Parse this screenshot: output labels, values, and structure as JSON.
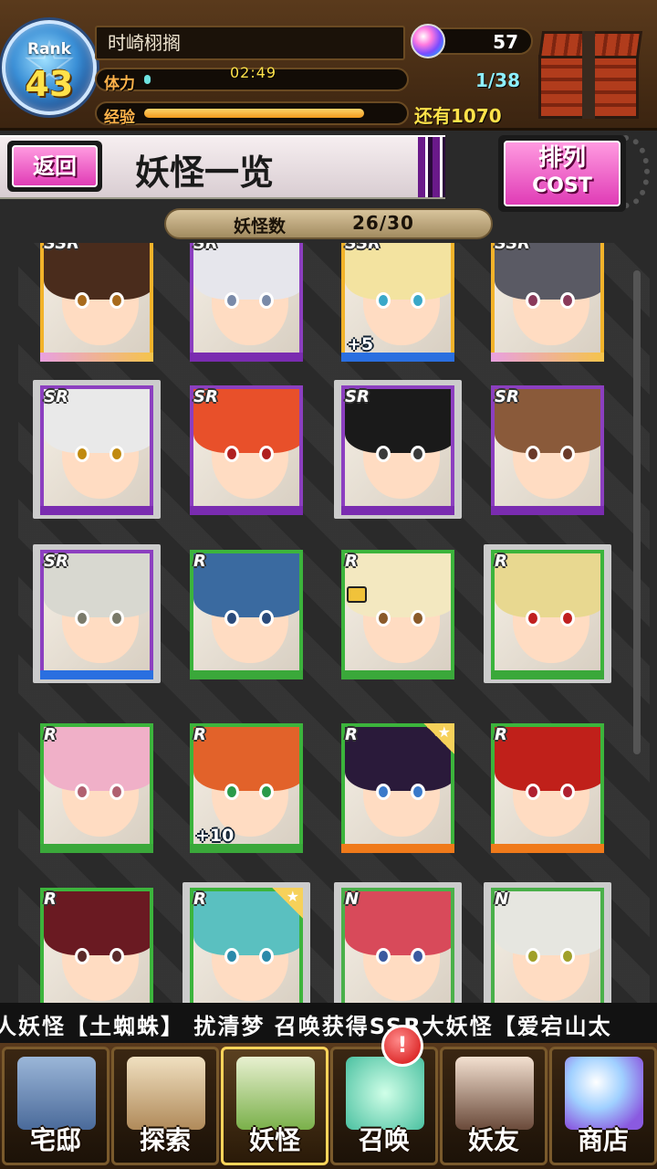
{
  "header": {
    "rank_label": "Rank",
    "rank_value": "43",
    "player_name": "时崎栩搁",
    "stamina_label": "体力",
    "stamina_timer": "02:49",
    "stamina_fraction": 0.026,
    "stamina_count": "1/38",
    "exp_label": "经验",
    "exp_fraction": 0.86,
    "exp_remaining": "还有1070",
    "gem_count": "57",
    "gem_icon": "gem-orb-icon",
    "present_icon": "present-box-icon"
  },
  "titlebar": {
    "back_label": "返回",
    "page_title": "妖怪一览",
    "sort_line1": "排列",
    "sort_line2": "COST"
  },
  "counter": {
    "label": "妖怪数",
    "value": "26/30"
  },
  "colors": {
    "accent_pink": "#e03cb6",
    "ssr_gold": "#f2b32a",
    "sr_purple": "#8c3fc0",
    "r_green": "#3cb43c",
    "highlight_yellow": "#ffe24a"
  },
  "cards": [
    {
      "rarity": "SSR",
      "plus": "",
      "hair": "#4a2c1c",
      "eyes": "#a86a1c"
    },
    {
      "rarity": "SR",
      "plus": "",
      "hair": "#e6e6ec",
      "eyes": "#7a8aa8"
    },
    {
      "rarity": "SSR",
      "plus": "+5",
      "hair": "#f3e3a0",
      "eyes": "#3aa8c8"
    },
    {
      "rarity": "SSR",
      "plus": "",
      "hair": "#5a5a64",
      "eyes": "#8a3a5a"
    },
    {
      "rarity": "SR",
      "plus": "",
      "hair": "#e9e9e9",
      "eyes": "#c08a10"
    },
    {
      "rarity": "SR",
      "plus": "",
      "hair": "#e8502a",
      "eyes": "#b02020"
    },
    {
      "rarity": "SR",
      "plus": "",
      "hair": "#1a1a1a",
      "eyes": "#3a3a3a"
    },
    {
      "rarity": "SR",
      "plus": "",
      "hair": "#8a5a3a",
      "eyes": "#6a3a2a"
    },
    {
      "rarity": "SR",
      "plus": "",
      "hair": "#d8d8d0",
      "eyes": "#7a7a6a"
    },
    {
      "rarity": "R",
      "plus": "",
      "hair": "#3a6aa0",
      "eyes": "#2a4a7a"
    },
    {
      "rarity": "R",
      "plus": "",
      "hair": "#f3e8c0",
      "eyes": "#8a5a2a"
    },
    {
      "rarity": "R",
      "plus": "",
      "hair": "#e8d890",
      "eyes": "#c02020"
    },
    {
      "rarity": "R",
      "plus": "",
      "hair": "#f0b0c8",
      "eyes": "#b06070"
    },
    {
      "rarity": "R",
      "plus": "+10",
      "hair": "#e2622a",
      "eyes": "#2a9a4a"
    },
    {
      "rarity": "R",
      "plus": "",
      "hair": "#2a1a3a",
      "eyes": "#3a7aca"
    },
    {
      "rarity": "R",
      "plus": "",
      "hair": "#c0201a",
      "eyes": "#b02030"
    },
    {
      "rarity": "R",
      "plus": "",
      "hair": "#6a1a22",
      "eyes": "#5a2a2a"
    },
    {
      "rarity": "R",
      "plus": "",
      "hair": "#5ac0c0",
      "eyes": "#2a8aaa"
    },
    {
      "rarity": "N",
      "plus": "",
      "hair": "#d84a5a",
      "eyes": "#3a5aa0"
    },
    {
      "rarity": "N",
      "plus": "",
      "hair": "#e6e6e0",
      "eyes": "#a0a02a"
    }
  ],
  "ticker_text": "人妖怪【土蜘蛛】 扰清梦 召唤获得SSR大妖怪【爱宕山太",
  "nav": [
    {
      "label": "宅邸",
      "icon": "mansion-icon"
    },
    {
      "label": "探索",
      "icon": "magnifier-map-icon"
    },
    {
      "label": "妖怪",
      "icon": "scroll-icon"
    },
    {
      "label": "召唤",
      "icon": "pentagram-icon"
    },
    {
      "label": "妖友",
      "icon": "catgirl-friend-icon"
    },
    {
      "label": "商店",
      "icon": "crystal-orb-icon"
    }
  ],
  "notify_badge": "!"
}
